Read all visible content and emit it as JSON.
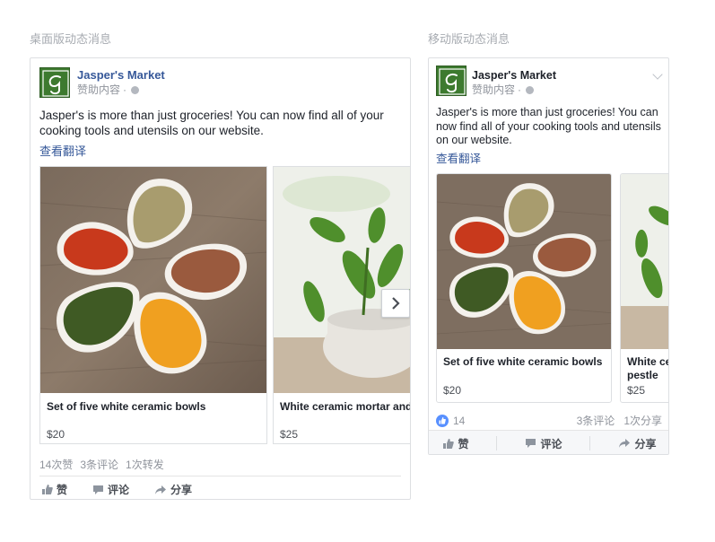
{
  "desktop": {
    "section_title": "桌面版动态消息",
    "page_name": "Jasper's Market",
    "sponsored": "赞助内容",
    "post_text": "Jasper's is more than just groceries! You can now find all of your cooking tools and utensils on our website.",
    "translate": "查看翻译",
    "items": [
      {
        "title": "Set of five white ceramic bowls",
        "price": "$20"
      },
      {
        "title": "White ceramic mortar and pestle",
        "price": "$25"
      }
    ],
    "stats": {
      "likes": "14次赞",
      "comments": "3条评论",
      "shares": "1次转发"
    },
    "actions": {
      "like": "赞",
      "comment": "评论",
      "share": "分享"
    }
  },
  "mobile": {
    "section_title": "移动版动态消息",
    "page_name": "Jasper's Market",
    "sponsored": "赞助内容",
    "post_text": "Jasper's is more than just groceries! You can now find all of your cooking tools and utensils on our website.",
    "translate": "查看翻译",
    "items": [
      {
        "title": "Set of five white ceramic bowls",
        "price": "$20"
      },
      {
        "title": "White ceramic mortar and pestle",
        "price": "$25"
      }
    ],
    "stats": {
      "likes": "14",
      "comments": "3条评论",
      "shares": "1次分享"
    },
    "actions": {
      "like": "赞",
      "comment": "评论",
      "share": "分享"
    }
  },
  "colors": {
    "link": "#365899",
    "logo_green": "#3d7a2f",
    "like_blue": "#5890ff"
  },
  "icons": [
    "logo-g-icon",
    "globe-icon",
    "chevron-right-icon",
    "chevron-down-icon",
    "thumbs-up-icon",
    "comment-icon",
    "share-arrow-icon"
  ]
}
